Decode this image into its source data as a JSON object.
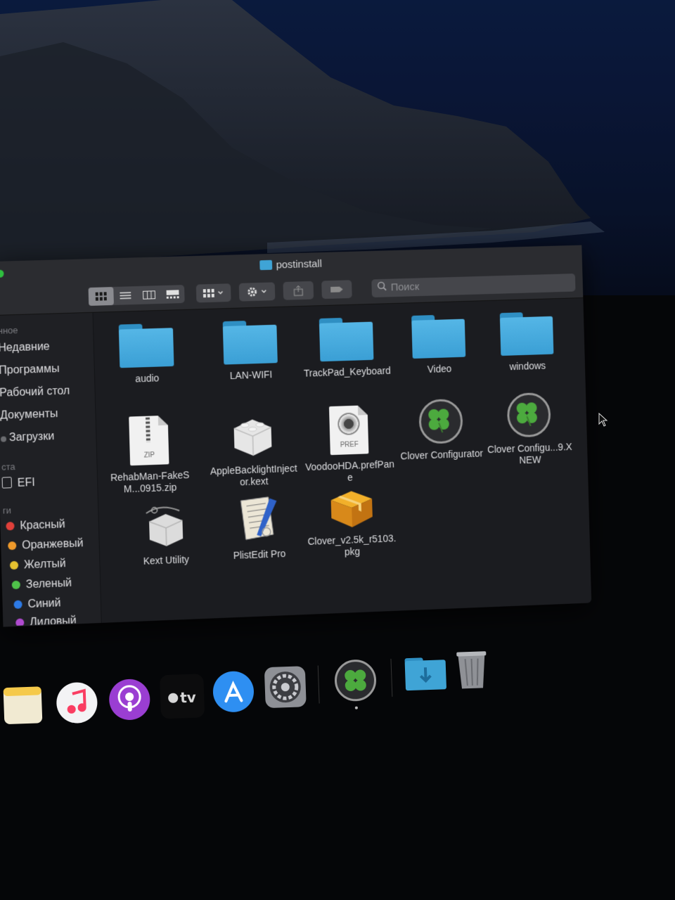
{
  "window": {
    "title": "postinstall"
  },
  "toolbar": {
    "search_placeholder": "Поиск"
  },
  "sidebar": {
    "sections": [
      {
        "label": "нное",
        "key": "favorites"
      },
      {
        "label": "ста",
        "key": "locations"
      },
      {
        "label": "ги",
        "key": "tags"
      }
    ],
    "favorites": [
      {
        "label": "Недавние"
      },
      {
        "label": "Программы"
      },
      {
        "label": "Рабочий стол"
      },
      {
        "label": "Документы"
      },
      {
        "label": "Загрузки"
      }
    ],
    "locations": [
      {
        "label": "EFI"
      }
    ],
    "tags": [
      {
        "label": "Красный",
        "color": "#e0403a"
      },
      {
        "label": "Оранжевый",
        "color": "#ef9a2b"
      },
      {
        "label": "Желтый",
        "color": "#e6c230"
      },
      {
        "label": "Зеленый",
        "color": "#4fc24a"
      },
      {
        "label": "Синий",
        "color": "#2d7ae5"
      },
      {
        "label": "Лиловый",
        "color": "#b04bd0"
      }
    ]
  },
  "files": [
    {
      "name": "audio",
      "icon": "folder-icon"
    },
    {
      "name": "LAN-WIFI",
      "icon": "folder-icon"
    },
    {
      "name": "TrackPad_Keyboard",
      "icon": "folder-icon"
    },
    {
      "name": "Video",
      "icon": "folder-icon"
    },
    {
      "name": "windows",
      "icon": "folder-icon"
    },
    {
      "name": "RehabMan-FakeSM...0915.zip",
      "icon": "zip-icon",
      "badge": "ZIP"
    },
    {
      "name": "AppleBacklightInjector.kext",
      "icon": "kext-lego-icon"
    },
    {
      "name": "VoodooHDA.prefPane",
      "icon": "prefpane-icon",
      "badge": "PREF"
    },
    {
      "name": "Clover Configurator",
      "icon": "clover-icon"
    },
    {
      "name": "Clover Configu...9.X NEW",
      "icon": "clover-icon"
    },
    {
      "name": "Kext Utility",
      "icon": "kext-utility-icon"
    },
    {
      "name": "PlistEdit Pro",
      "icon": "plist-icon"
    },
    {
      "name": "Clover_v2.5k_r5103.pkg",
      "icon": "package-icon"
    }
  ],
  "dock": {
    "items": [
      {
        "name": "notes-icon"
      },
      {
        "name": "music-icon"
      },
      {
        "name": "podcasts-icon"
      },
      {
        "name": "apple-tv-icon",
        "label": "tv"
      },
      {
        "name": "app-store-icon"
      },
      {
        "name": "system-preferences-icon"
      },
      {
        "name": "clover-configurator-icon"
      },
      {
        "name": "downloads-folder-icon"
      },
      {
        "name": "trash-icon"
      }
    ]
  },
  "colors": {
    "folder": "#3fa4d6",
    "window_bg": "#1b1c20",
    "toolbar_bg": "#2b2c30",
    "wallpaper": "#0a1a3d"
  }
}
